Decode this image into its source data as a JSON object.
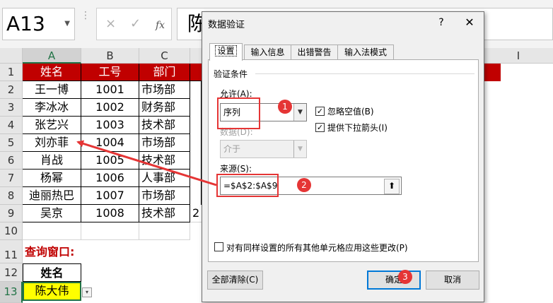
{
  "formula_bar": {
    "name_box": "A13",
    "cancel_glyph": "×",
    "enter_glyph": "✓",
    "fx_glyph": "fx",
    "formula_text": "陈"
  },
  "grid": {
    "columns": [
      "A",
      "B",
      "C",
      "I"
    ],
    "row_numbers": [
      "1",
      "2",
      "3",
      "4",
      "5",
      "6",
      "7",
      "8",
      "9",
      "10",
      "11",
      "12",
      "13"
    ],
    "header_row": [
      "姓名",
      "工号",
      "部门"
    ],
    "data_rows": [
      [
        "王一博",
        "1001",
        "市场部"
      ],
      [
        "李冰冰",
        "1002",
        "财务部"
      ],
      [
        "张艺兴",
        "1003",
        "技术部"
      ],
      [
        "刘亦菲",
        "1004",
        "市场部"
      ],
      [
        "肖战",
        "1005",
        "技术部"
      ],
      [
        "杨幂",
        "1006",
        "人事部"
      ],
      [
        "迪丽热巴",
        "1007",
        "市场部"
      ],
      [
        "吴京",
        "1008",
        "技术部"
      ]
    ],
    "row9_partial": "2",
    "query_title": "查询窗口:",
    "query_header": "姓名",
    "query_value": "陈大伟",
    "dropdown_glyph": "▾"
  },
  "dialog": {
    "title": "数据验证",
    "help": "?",
    "close": "✕",
    "tabs": [
      "设置",
      "输入信息",
      "出错警告",
      "输入法模式"
    ],
    "section_title": "验证条件",
    "allow_label": "允许(A):",
    "allow_value": "序列",
    "data_label": "数据(D):",
    "data_value": "介于",
    "ignore_blank_label": "忽略空值(B)",
    "ignore_blank_checked": true,
    "dropdown_arrow_label": "提供下拉箭头(I)",
    "dropdown_arrow_checked": true,
    "source_label": "来源(S):",
    "source_value": "=$A$2:$A$9",
    "apply_all_label": "对有同样设置的所有其他单元格应用这些更改(P)",
    "apply_all_checked": false,
    "clear_all_button": "全部清除(C)",
    "ok_button": "确定",
    "cancel_button": "取消"
  },
  "annotations": {
    "badges": [
      "1",
      "2",
      "3"
    ],
    "color": "#e53535"
  },
  "colors": {
    "header_fill": "#c00000",
    "query_title": "#c00000",
    "highlight": "#ffff00",
    "excel_green": "#217346"
  }
}
